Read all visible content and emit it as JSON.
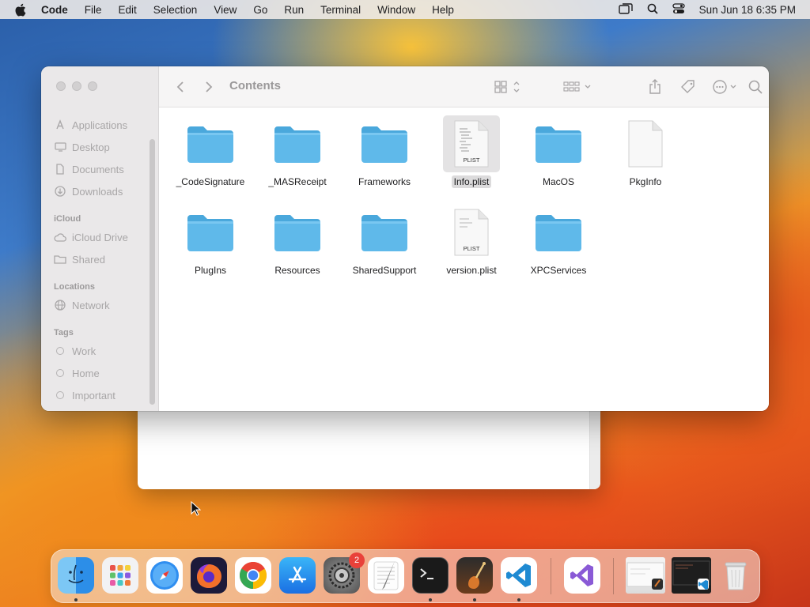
{
  "menubar": {
    "apple_icon": "apple-icon",
    "items": [
      "Code",
      "File",
      "Edit",
      "Selection",
      "View",
      "Go",
      "Run",
      "Terminal",
      "Window",
      "Help"
    ],
    "clock": "Sun Jun 18  6:35 PM",
    "status_icons": [
      "screen-mirroring-icon",
      "spotlight-search-icon",
      "control-center-icon"
    ]
  },
  "finder": {
    "title": "Contents",
    "sidebar": {
      "favorites": [
        {
          "label": "Applications",
          "icon": "applications-icon"
        },
        {
          "label": "Desktop",
          "icon": "desktop-icon"
        },
        {
          "label": "Documents",
          "icon": "document-icon"
        },
        {
          "label": "Downloads",
          "icon": "downloads-icon"
        }
      ],
      "icloud_heading": "iCloud",
      "icloud": [
        {
          "label": "iCloud Drive",
          "icon": "cloud-icon"
        },
        {
          "label": "Shared",
          "icon": "shared-folder-icon"
        }
      ],
      "locations_heading": "Locations",
      "locations": [
        {
          "label": "Network",
          "icon": "globe-icon"
        }
      ],
      "tags_heading": "Tags",
      "tags": [
        {
          "label": "Work"
        },
        {
          "label": "Home"
        },
        {
          "label": "Important"
        }
      ]
    },
    "files": [
      {
        "name": "_CodeSignature",
        "kind": "folder"
      },
      {
        "name": "_MASReceipt",
        "kind": "folder"
      },
      {
        "name": "Frameworks",
        "kind": "folder"
      },
      {
        "name": "Info.plist",
        "kind": "plist",
        "badge": "PLIST",
        "selected": true
      },
      {
        "name": "MacOS",
        "kind": "folder"
      },
      {
        "name": "PkgInfo",
        "kind": "file"
      },
      {
        "name": "PlugIns",
        "kind": "folder"
      },
      {
        "name": "Resources",
        "kind": "folder"
      },
      {
        "name": "SharedSupport",
        "kind": "folder"
      },
      {
        "name": "version.plist",
        "kind": "plist",
        "badge": "PLIST"
      },
      {
        "name": "XPCServices",
        "kind": "folder"
      }
    ]
  },
  "dock": {
    "apps": [
      "finder",
      "launchpad",
      "safari",
      "firefox",
      "chrome",
      "app-store",
      "system-settings",
      "textedit",
      "terminal",
      "instruments",
      "vscode",
      "visual-studio"
    ],
    "settings_badge": "2",
    "colors": {
      "folder": "#5fb9ea",
      "vscode": "#1f8ad2",
      "badge": "#e9413a"
    }
  }
}
